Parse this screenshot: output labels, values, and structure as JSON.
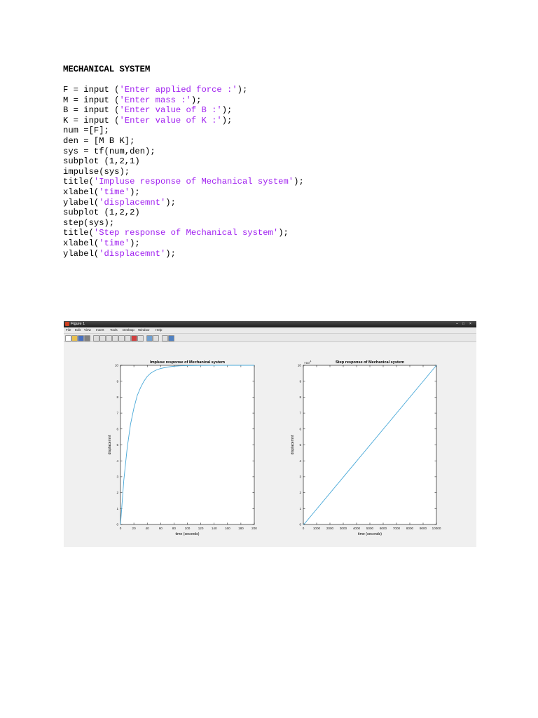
{
  "heading": "MECHANICAL SYSTEM",
  "code_lines": [
    [
      {
        "t": "F = input ("
      },
      {
        "t": "'Enter applied force :'",
        "s": 1
      },
      {
        "t": ");"
      }
    ],
    [
      {
        "t": "M = input ("
      },
      {
        "t": "'Enter mass :'",
        "s": 1
      },
      {
        "t": ");"
      }
    ],
    [
      {
        "t": "B = input ("
      },
      {
        "t": "'Enter value of B :'",
        "s": 1
      },
      {
        "t": ");"
      }
    ],
    [
      {
        "t": "K = input ("
      },
      {
        "t": "'Enter value of K :'",
        "s": 1
      },
      {
        "t": ");"
      }
    ],
    [
      {
        "t": "num =[F];"
      }
    ],
    [
      {
        "t": "den = [M B K];"
      }
    ],
    [
      {
        "t": "sys = tf(num,den);"
      }
    ],
    [
      {
        "t": "subplot (1,2,1)"
      }
    ],
    [
      {
        "t": "impulse(sys);"
      }
    ],
    [
      {
        "t": "title("
      },
      {
        "t": "'Impluse response of Mechanical system'",
        "s": 1
      },
      {
        "t": ");"
      }
    ],
    [
      {
        "t": "xlabel("
      },
      {
        "t": "'time'",
        "s": 1
      },
      {
        "t": ");"
      }
    ],
    [
      {
        "t": "ylabel("
      },
      {
        "t": "'displacemnt'",
        "s": 1
      },
      {
        "t": ");"
      }
    ],
    [
      {
        "t": "subplot (1,2,2)"
      }
    ],
    [
      {
        "t": "step(sys);"
      }
    ],
    [
      {
        "t": "title("
      },
      {
        "t": "'Step response of Mechanical system'",
        "s": 1
      },
      {
        "t": ");"
      }
    ],
    [
      {
        "t": "xlabel("
      },
      {
        "t": "'time'",
        "s": 1
      },
      {
        "t": ");"
      }
    ],
    [
      {
        "t": "ylabel("
      },
      {
        "t": "'displacemnt'",
        "s": 1
      },
      {
        "t": ");"
      }
    ]
  ],
  "figure": {
    "window_title": "Figure 1",
    "window_controls": [
      "–",
      "□",
      "×"
    ],
    "menu": [
      "File",
      "Edit",
      "View",
      "Insert",
      "Tools",
      "Desktop",
      "Window",
      "Help"
    ],
    "toolbar_icons": [
      "new-icon",
      "open-icon",
      "save-icon",
      "print-icon",
      "pointer-icon",
      "zoom-in-icon",
      "zoom-out-icon",
      "pan-icon",
      "rotate-icon",
      "data-cursor-icon",
      "brush-icon",
      "link-icon",
      "colorbar-icon",
      "legend-icon",
      "hide-plot-icon",
      "show-plot-icon"
    ],
    "colors": {
      "line": "#48a8d8",
      "axes": "#000000",
      "background": "#f0f0f0",
      "plot_area": "#ffffff"
    }
  },
  "chart_data": [
    {
      "type": "line",
      "title": "Impluse response of Mechanical system",
      "xlabel": "time (seconds)",
      "ylabel": "displacemnt",
      "xlim": [
        0,
        200
      ],
      "ylim": [
        0,
        10
      ],
      "xticks": [
        0,
        20,
        40,
        60,
        80,
        100,
        120,
        140,
        160,
        180,
        200
      ],
      "yticks": [
        0,
        1,
        2,
        3,
        4,
        5,
        6,
        7,
        8,
        9,
        10
      ],
      "exponent": "",
      "x": [
        0,
        5,
        10,
        15,
        20,
        25,
        30,
        35,
        40,
        45,
        50,
        55,
        60,
        70,
        80,
        90,
        100,
        120,
        140,
        160,
        180,
        200
      ],
      "series": [
        {
          "values": [
            0,
            2.8,
            4.8,
            6.3,
            7.3,
            8.1,
            8.6,
            9.0,
            9.3,
            9.5,
            9.63,
            9.73,
            9.8,
            9.89,
            9.94,
            9.97,
            9.98,
            9.99,
            10,
            10,
            10,
            10
          ]
        }
      ]
    },
    {
      "type": "line",
      "title": "Step response of Mechanical system",
      "xlabel": "time (seconds)",
      "ylabel": "displacemnt",
      "xlim": [
        0,
        10000
      ],
      "ylim": [
        0,
        10
      ],
      "xticks": [
        0,
        1000,
        2000,
        3000,
        4000,
        5000,
        6000,
        7000,
        8000,
        9000,
        10000
      ],
      "yticks": [
        0,
        1,
        2,
        3,
        4,
        5,
        6,
        7,
        8,
        9,
        10
      ],
      "exponent": "×10",
      "exponent_power": "4",
      "x": [
        0,
        100,
        10000
      ],
      "series": [
        {
          "values": [
            0,
            0.06,
            10
          ]
        }
      ]
    }
  ]
}
